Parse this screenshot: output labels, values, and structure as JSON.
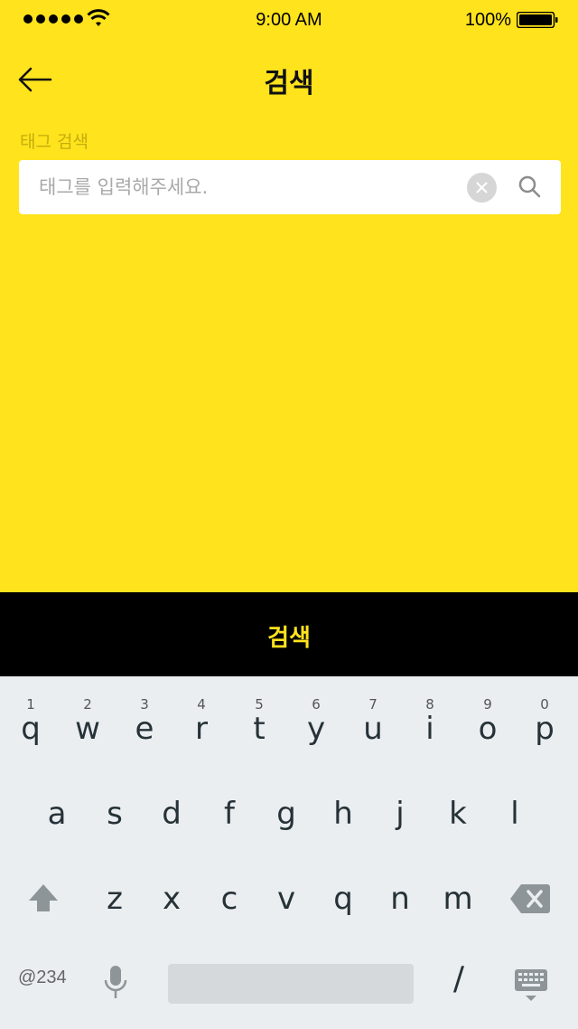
{
  "status_bar": {
    "time": "9:00 AM",
    "battery_percent": "100%",
    "signal_icon": "signal-dots-icon",
    "wifi_icon": "wifi-icon",
    "battery_icon": "battery-icon"
  },
  "header": {
    "title": "검색",
    "back_icon": "arrow-left-icon"
  },
  "search": {
    "label": "태그 검색",
    "placeholder": "태그를 입력해주세요.",
    "value": "",
    "clear_icon": "close-circle-icon",
    "search_icon": "search-icon"
  },
  "bottom_button": {
    "label": "검색"
  },
  "keyboard": {
    "row1": [
      {
        "ch": "q",
        "hint": "1"
      },
      {
        "ch": "w",
        "hint": "2"
      },
      {
        "ch": "e",
        "hint": "3"
      },
      {
        "ch": "r",
        "hint": "4"
      },
      {
        "ch": "t",
        "hint": "5"
      },
      {
        "ch": "y",
        "hint": "6"
      },
      {
        "ch": "u",
        "hint": "7"
      },
      {
        "ch": "i",
        "hint": "8"
      },
      {
        "ch": "o",
        "hint": "9"
      },
      {
        "ch": "p",
        "hint": "0"
      }
    ],
    "row2": [
      "a",
      "s",
      "d",
      "f",
      "g",
      "h",
      "j",
      "k",
      "l"
    ],
    "row3": [
      "z",
      "x",
      "c",
      "v",
      "q",
      "n",
      "m"
    ],
    "symbols_label": "@234",
    "slash_label": "/",
    "shift_icon": "shift-arrow-icon",
    "backspace_icon": "backspace-icon",
    "mic_icon": "microphone-icon",
    "hide_keyboard_icon": "keyboard-hide-icon"
  },
  "colors": {
    "background": "#FFE31C",
    "button_bg": "#000000",
    "button_text": "#FFE31C",
    "label_text": "#C5AE0C",
    "keyboard_bg": "#EAEEF0"
  }
}
